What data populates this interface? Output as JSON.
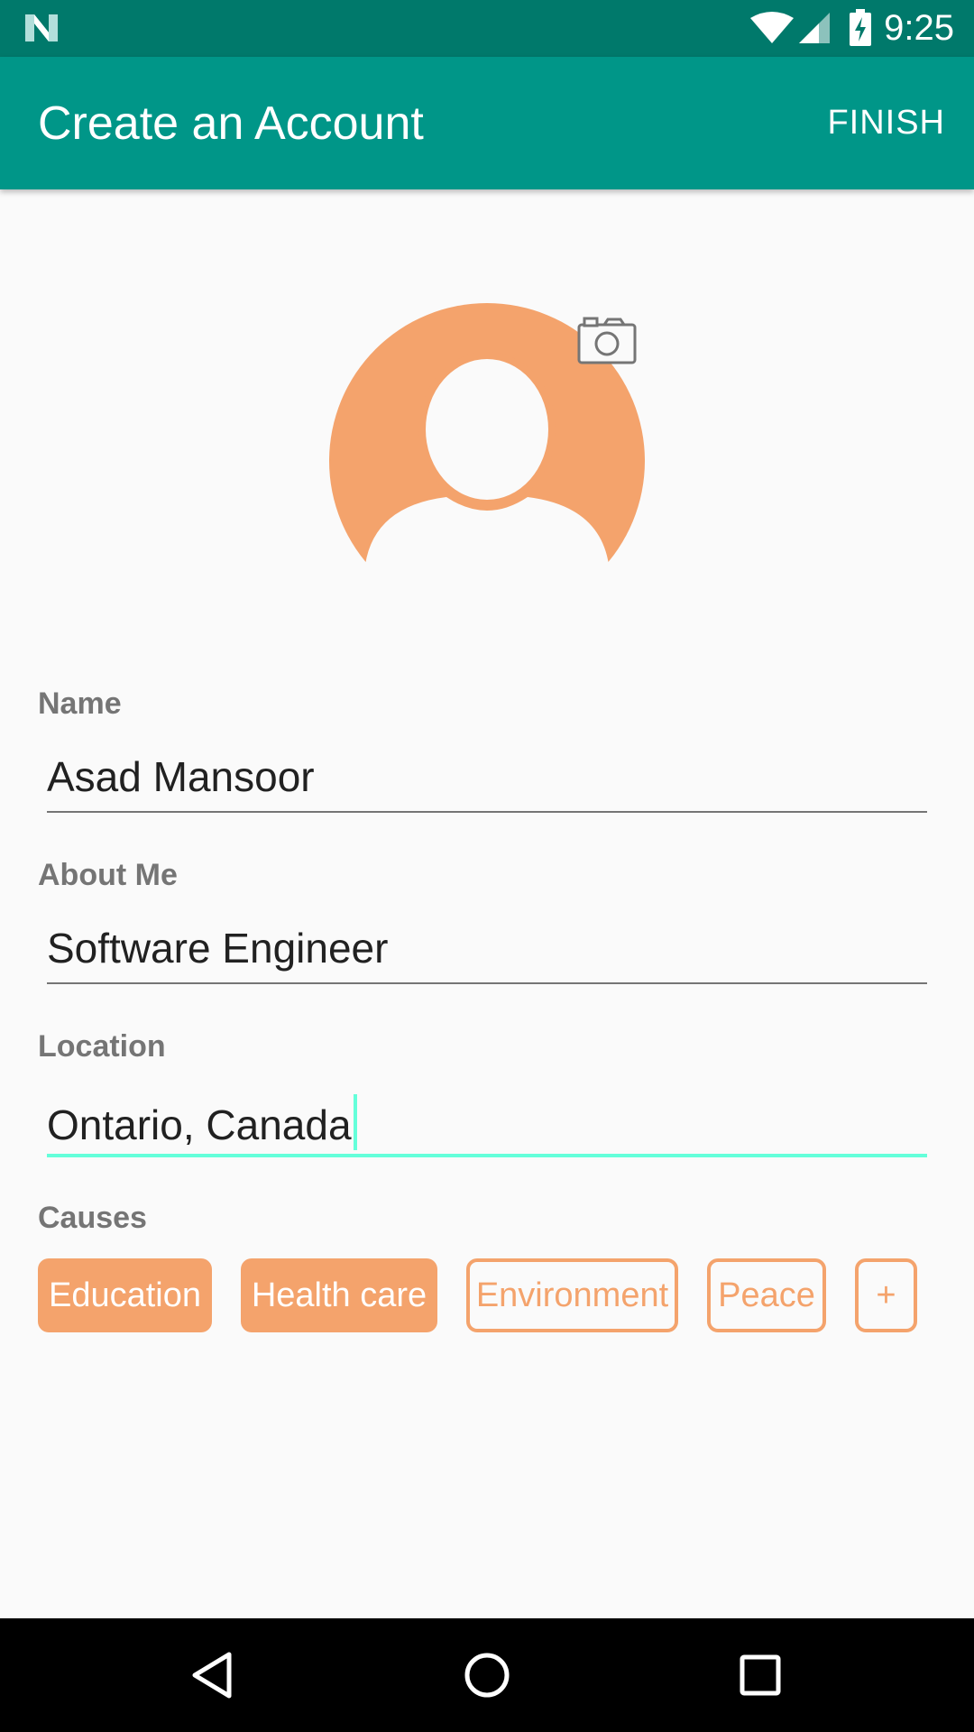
{
  "status_bar": {
    "time": "9:25",
    "icons": [
      "n-logo-icon",
      "wifi-icon",
      "signal-icon",
      "battery-charging-icon"
    ]
  },
  "app_bar": {
    "title": "Create an Account",
    "action_label": "FINISH"
  },
  "avatar": {
    "icon": "person-avatar-icon",
    "action_icon": "camera-icon"
  },
  "form": {
    "name": {
      "label": "Name",
      "value": "Asad Mansoor"
    },
    "about": {
      "label": "About Me",
      "value": "Software Engineer"
    },
    "location": {
      "label": "Location",
      "value": "Ontario, Canada"
    }
  },
  "causes": {
    "label": "Causes",
    "chips": [
      {
        "label": "Education",
        "selected": true
      },
      {
        "label": "Health care",
        "selected": true
      },
      {
        "label": "Environment",
        "selected": false
      },
      {
        "label": "Peace",
        "selected": false
      },
      {
        "label": "+",
        "selected": false
      }
    ]
  },
  "nav_bar": {
    "icons": [
      "back-icon",
      "home-icon",
      "recents-icon"
    ]
  },
  "colors": {
    "status_bar": "#00796b",
    "app_bar": "#009688",
    "accent": "#64ffda",
    "chip": "#f4a36c",
    "avatar": "#f4a36c",
    "label": "#757575"
  }
}
